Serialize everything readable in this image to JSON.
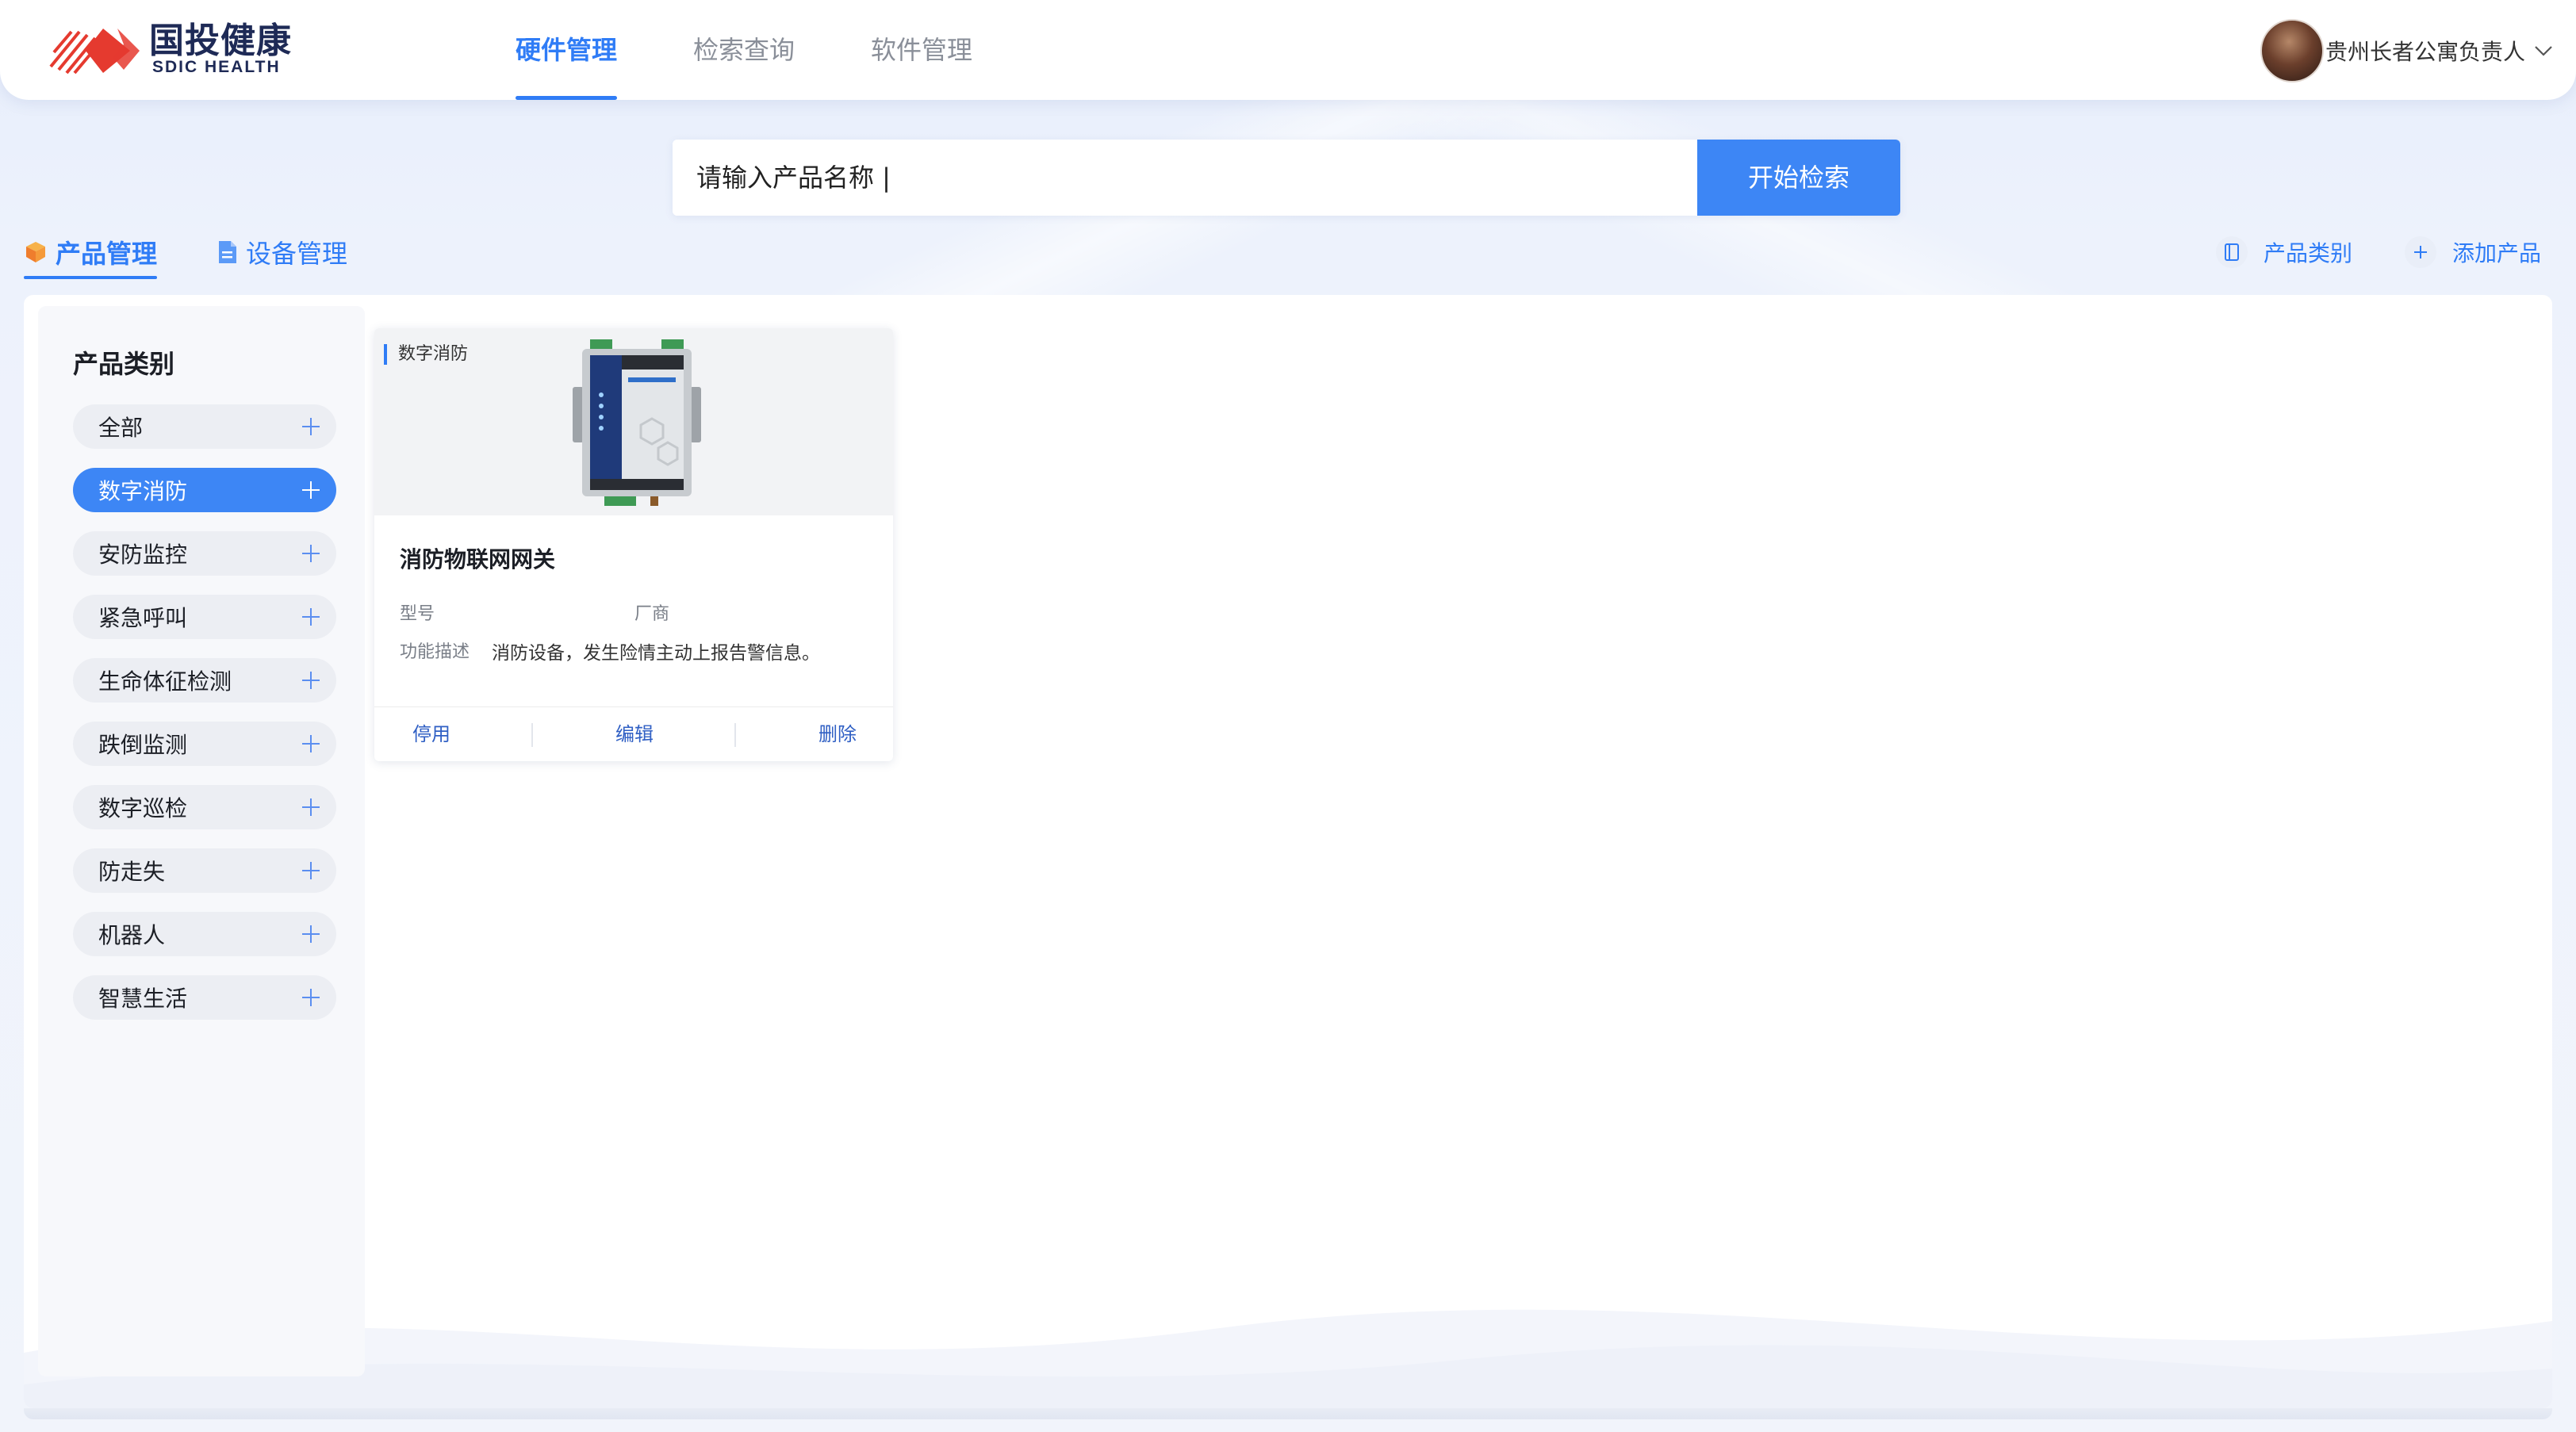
{
  "brand": {
    "name_cn": "国投健康",
    "name_en": "SDIC HEALTH",
    "accent": "#2f7cf6",
    "logo_red": "#e53a2f"
  },
  "nav": {
    "tabs": [
      {
        "label": "硬件管理",
        "active": true
      },
      {
        "label": "检索查询",
        "active": false
      },
      {
        "label": "软件管理",
        "active": false
      }
    ]
  },
  "user": {
    "name": "贵州长者公寓负责人"
  },
  "search": {
    "placeholder": "请输入产品名称 |",
    "button_label": "开始检索"
  },
  "subtabs": {
    "product": {
      "label": "产品管理",
      "active": true,
      "icon": "cube-icon"
    },
    "device": {
      "label": "设备管理",
      "active": false,
      "icon": "document-icon"
    }
  },
  "actions": {
    "category": {
      "label": "产品类别",
      "icon": "category-icon"
    },
    "add": {
      "label": "添加产品",
      "icon": "plus-icon"
    }
  },
  "sidebar": {
    "title": "产品类别",
    "categories": [
      {
        "label": "全部"
      },
      {
        "label": "数字消防",
        "active": true
      },
      {
        "label": "安防监控"
      },
      {
        "label": "紧急呼叫"
      },
      {
        "label": "生命体征检测"
      },
      {
        "label": "跌倒监测"
      },
      {
        "label": "数字巡检"
      },
      {
        "label": "防走失"
      },
      {
        "label": "机器人"
      },
      {
        "label": "智慧生活"
      }
    ]
  },
  "products": [
    {
      "tag": "数字消防",
      "name": "消防物联网网关",
      "model_label": "型号",
      "vendor_label": "厂商",
      "desc_label": "功能描述",
      "desc": "消防设备，发生险情主动上报告警信息。",
      "actions": {
        "disable": "停用",
        "edit": "编辑",
        "delete": "删除"
      }
    }
  ]
}
